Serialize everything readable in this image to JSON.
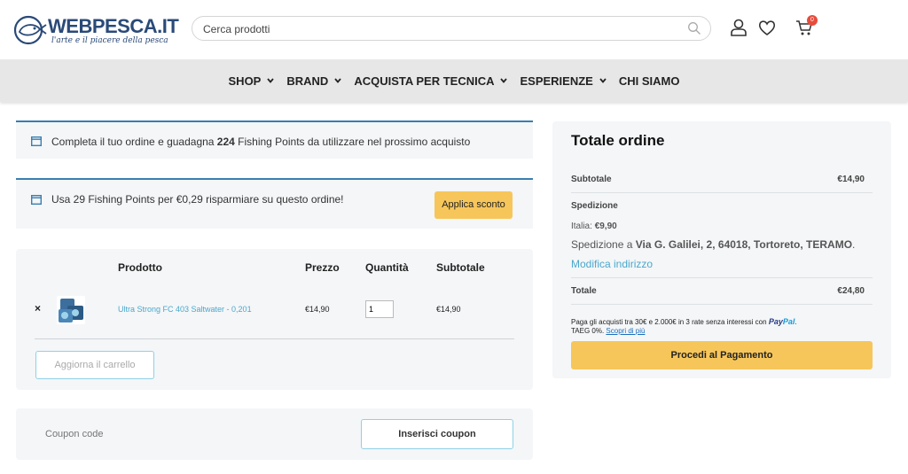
{
  "header": {
    "logo_text": "WEBPESCA.IT",
    "logo_tagline": "l'arte e il piacere della pesca",
    "search_placeholder": "Cerca prodotti",
    "cart_count": "0"
  },
  "nav": {
    "items": [
      {
        "label": "SHOP",
        "has_dropdown": true
      },
      {
        "label": "BRAND",
        "has_dropdown": true
      },
      {
        "label": "ACQUISTA PER TECNICA",
        "has_dropdown": true
      },
      {
        "label": "ESPERIENZE",
        "has_dropdown": true
      },
      {
        "label": "CHI SIAMO",
        "has_dropdown": false
      }
    ]
  },
  "notice_points": {
    "prefix": "Completa il tuo ordine e guadagna ",
    "points": "224",
    "suffix": " Fishing Points da utilizzare nel prossimo acquisto"
  },
  "notice_redeem": {
    "text": "Usa 29 Fishing Points per €0,29 risparmiare su questo ordine!",
    "button": "Applica sconto"
  },
  "cart": {
    "headers": {
      "product": "Prodotto",
      "price": "Prezzo",
      "quantity": "Quantità",
      "subtotal": "Subtotale"
    },
    "items": [
      {
        "remove": "×",
        "name": "Ultra Strong FC 403 Saltwater - 0,201",
        "price": "€14,90",
        "quantity": "1",
        "subtotal": "€14,90"
      }
    ],
    "update_button": "Aggiorna il carrello"
  },
  "coupon": {
    "placeholder": "Coupon code",
    "button": "Inserisci coupon"
  },
  "summary": {
    "title": "Totale ordine",
    "subtotal_label": "Subtotale",
    "subtotal_value": "€14,90",
    "shipping_label": "Spedizione",
    "shipping_method_prefix": "Italia: ",
    "shipping_method_price": "€9,90",
    "shipping_to_prefix": "Spedizione a ",
    "shipping_address": "Via G. Galilei, 2, 64018, Tortoreto, TERAMO",
    "shipping_to_suffix": ".",
    "change_address": "Modifica indirizzo",
    "total_label": "Totale",
    "total_value": "€24,80",
    "paypal_text": "Paga gli acquisti tra 30€ e 2.000€ in 3 rate senza interessi con",
    "paypal_brand_a": "Pay",
    "paypal_brand_b": "Pal",
    "paypal_dot": ".",
    "taeg_text": "TAEG 0%. ",
    "learn_more": "Scopri di più",
    "checkout_button": "Procedi al Pagamento"
  },
  "colors": {
    "accent_blue": "#3a7fb0",
    "link_blue": "#4aa8cc",
    "button_yellow": "#f7c65a",
    "panel_bg": "#f4f6f8",
    "nav_bg": "#e7e7e7",
    "logo_navy": "#2a4a78"
  }
}
